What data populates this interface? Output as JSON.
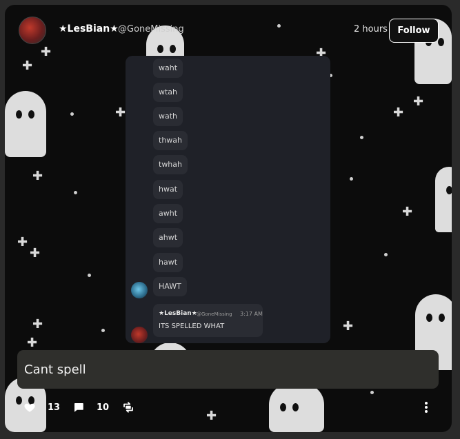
{
  "post": {
    "username": "★LesBian★",
    "handle": "@GoneMissing",
    "time": "2 hours",
    "follow_label": "Follow",
    "caption": "Cant spell"
  },
  "screenshot": {
    "messages": [
      "waht",
      "wtah",
      "wath",
      "thwah",
      "twhah",
      "hwat",
      "awht",
      "ahwt",
      "hawt",
      "HAWT"
    ],
    "reply": {
      "name": "★LesBian★",
      "handle": "@GoneMissing",
      "time": "3:17 AM",
      "text": "ITS SPELLED WHAT"
    }
  },
  "actions": {
    "likes": "13",
    "comments": "10"
  },
  "icons": [
    "heart-icon",
    "comment-icon",
    "reblog-icon",
    "more-icon"
  ]
}
